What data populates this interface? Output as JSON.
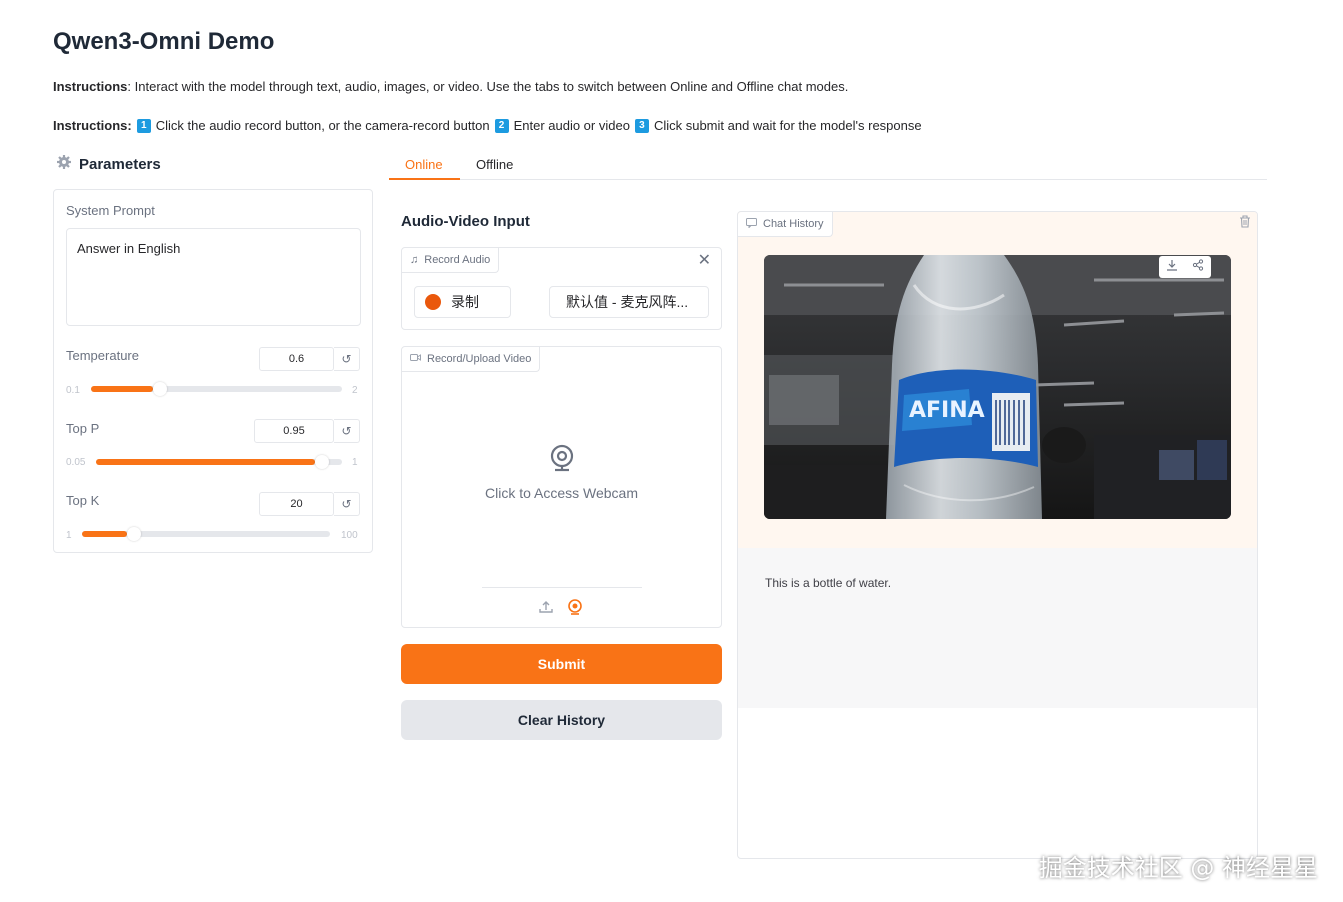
{
  "page": {
    "title": "Qwen3-Omni Demo",
    "instructions_label": "Instructions",
    "instructions_text": ": Interact with the model through text, audio, images, or video. Use the tabs to switch between Online and Offline chat modes.",
    "steps_label": "Instructions:",
    "steps": [
      {
        "num": "1",
        "text": "Click the audio record button, or the camera-record button"
      },
      {
        "num": "2",
        "text": "Enter audio or video"
      },
      {
        "num": "3",
        "text": "Click submit and wait for the model's response"
      }
    ]
  },
  "parameters": {
    "heading": "Parameters",
    "system_prompt_label": "System Prompt",
    "system_prompt_value": "Answer in English",
    "temperature": {
      "label": "Temperature",
      "value": "0.6",
      "min": "0.1",
      "max": "2",
      "level": 0.6
    },
    "top_p": {
      "label": "Top P",
      "value": "0.95",
      "min": "0.05",
      "max": "1",
      "level": 0.95
    },
    "top_k": {
      "label": "Top K",
      "value": "20",
      "min": "1",
      "max": "100",
      "level": 20
    },
    "reset_icon": "refresh-icon"
  },
  "tabs": {
    "online": "Online",
    "offline": "Offline",
    "active": "Online"
  },
  "audio_video": {
    "heading": "Audio-Video Input",
    "record_audio_label": "Record Audio",
    "record_button": "录制",
    "mic_select": "默认值 - 麦克风阵...",
    "video_label": "Record/Upload Video",
    "webcam_text": "Click to Access Webcam",
    "submit": "Submit",
    "clear": "Clear History"
  },
  "chat": {
    "label": "Chat History",
    "bot_reply": "This is a bottle of water.",
    "image_subject": "water bottle held in front of webcam in office",
    "bottle_label_text": "AFINA"
  },
  "watermark": "掘金技术社区 @ 神经星星",
  "colors": {
    "accent": "#f97316",
    "badge": "#1d9be0"
  }
}
